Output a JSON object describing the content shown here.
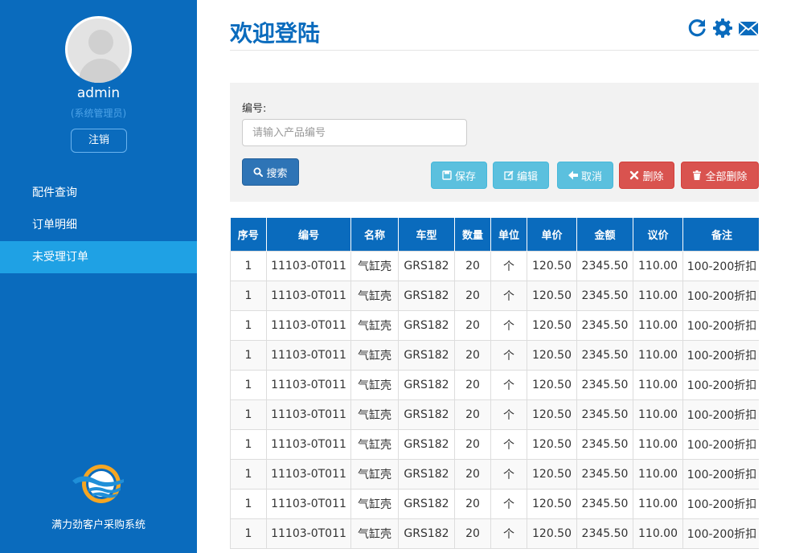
{
  "sidebar": {
    "username": "admin",
    "role": "(系统管理员)",
    "logout_label": "注销",
    "items": [
      {
        "label": "配件查询",
        "active": false
      },
      {
        "label": "订单明细",
        "active": false
      },
      {
        "label": "未受理订单",
        "active": true
      }
    ],
    "system_name": "满力劲客户采购系统"
  },
  "header": {
    "title": "欢迎登陆",
    "icons": [
      "refresh-icon",
      "gear-icon",
      "envelope-icon"
    ]
  },
  "search": {
    "label": "编号:",
    "placeholder": "请输入产品编号",
    "value": "",
    "search_label": "搜索"
  },
  "actions": {
    "save_label": "保存",
    "edit_label": "编辑",
    "cancel_label": "取消",
    "delete_label": "删除",
    "delete_all_label": "全部删除"
  },
  "table": {
    "headers": [
      "序号",
      "编号",
      "名称",
      "车型",
      "数量",
      "单位",
      "单价",
      "金额",
      "议价",
      "备注"
    ],
    "rows": [
      [
        "1",
        "11103-0T011",
        "气缸壳",
        "GRS182",
        "20",
        "个",
        "120.50",
        "2345.50",
        "110.00",
        "100-200折扣"
      ],
      [
        "1",
        "11103-0T011",
        "气缸壳",
        "GRS182",
        "20",
        "个",
        "120.50",
        "2345.50",
        "110.00",
        "100-200折扣"
      ],
      [
        "1",
        "11103-0T011",
        "气缸壳",
        "GRS182",
        "20",
        "个",
        "120.50",
        "2345.50",
        "110.00",
        "100-200折扣"
      ],
      [
        "1",
        "11103-0T011",
        "气缸壳",
        "GRS182",
        "20",
        "个",
        "120.50",
        "2345.50",
        "110.00",
        "100-200折扣"
      ],
      [
        "1",
        "11103-0T011",
        "气缸壳",
        "GRS182",
        "20",
        "个",
        "120.50",
        "2345.50",
        "110.00",
        "100-200折扣"
      ],
      [
        "1",
        "11103-0T011",
        "气缸壳",
        "GRS182",
        "20",
        "个",
        "120.50",
        "2345.50",
        "110.00",
        "100-200折扣"
      ],
      [
        "1",
        "11103-0T011",
        "气缸壳",
        "GRS182",
        "20",
        "个",
        "120.50",
        "2345.50",
        "110.00",
        "100-200折扣"
      ],
      [
        "1",
        "11103-0T011",
        "气缸壳",
        "GRS182",
        "20",
        "个",
        "120.50",
        "2345.50",
        "110.00",
        "100-200折扣"
      ],
      [
        "1",
        "11103-0T011",
        "气缸壳",
        "GRS182",
        "20",
        "个",
        "120.50",
        "2345.50",
        "110.00",
        "100-200折扣"
      ],
      [
        "1",
        "11103-0T011",
        "气缸壳",
        "GRS182",
        "20",
        "个",
        "120.50",
        "2345.50",
        "110.00",
        "100-200折扣"
      ]
    ]
  },
  "colors": {
    "sidebar": "#0a6bbd",
    "nav_active": "#1fa1e4",
    "accent": "#0a6bbd",
    "info_button": "#5bc0de",
    "danger_button": "#d9534f",
    "primary_button": "#2e74b6"
  }
}
